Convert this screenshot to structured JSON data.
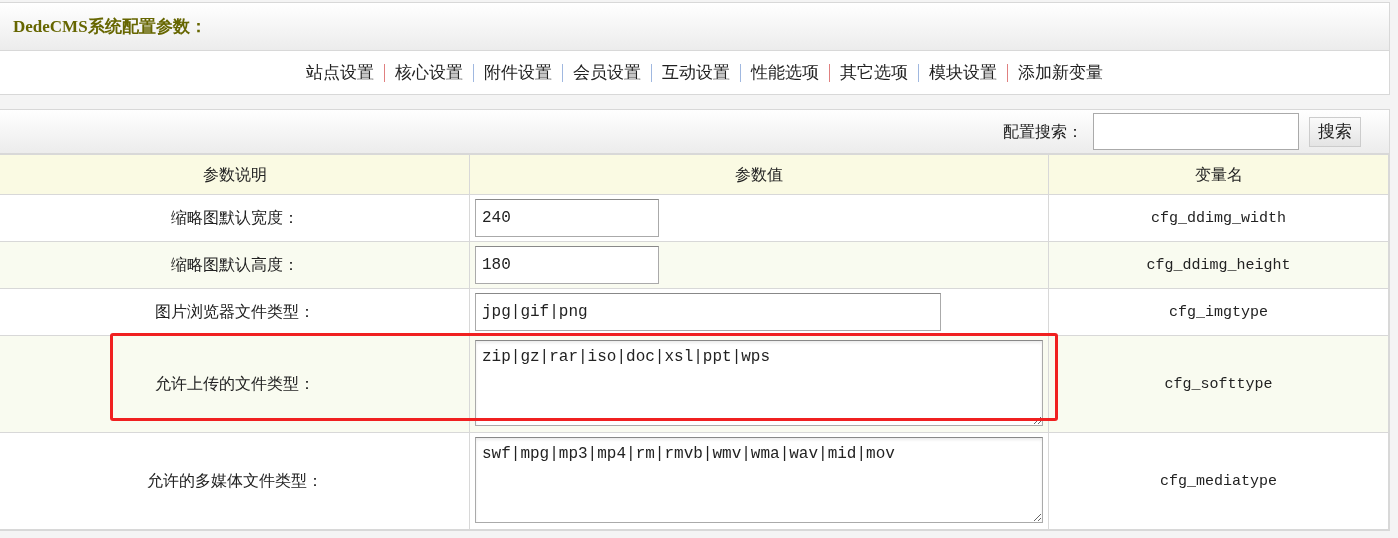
{
  "title": "DedeCMS系统配置参数：",
  "nav": [
    {
      "label": "站点设置",
      "color": "#e08080"
    },
    {
      "label": "核心设置",
      "color": "#a0b8e0"
    },
    {
      "label": "附件设置",
      "color": "#a0b8e0"
    },
    {
      "label": "会员设置",
      "color": "#a0b8e0"
    },
    {
      "label": "互动设置",
      "color": "#a0b8e0"
    },
    {
      "label": "性能选项",
      "color": "#e08080"
    },
    {
      "label": "其它选项",
      "color": "#a0b8e0"
    },
    {
      "label": "模块设置",
      "color": "#e08080"
    },
    {
      "label": "添加新变量"
    }
  ],
  "search": {
    "label": "配置搜索：",
    "button": "搜索"
  },
  "table": {
    "columns": [
      "参数说明",
      "参数值",
      "变量名"
    ],
    "rows": [
      {
        "label": "缩略图默认宽度：",
        "kind": "short",
        "value": "240",
        "variable": "cfg_ddimg_width",
        "highlighted": false
      },
      {
        "label": "缩略图默认高度：",
        "kind": "short",
        "value": "180",
        "variable": "cfg_ddimg_height",
        "highlighted": false
      },
      {
        "label": "图片浏览器文件类型：",
        "kind": "long",
        "value": "jpg|gif|png",
        "variable": "cfg_imgtype",
        "highlighted": false
      },
      {
        "label": "允许上传的文件类型：",
        "kind": "textarea",
        "value": "zip|gz|rar|iso|doc|xsl|ppt|wps",
        "variable": "cfg_softtype",
        "highlighted": true
      },
      {
        "label": "允许的多媒体文件类型：",
        "kind": "textarea",
        "value": "swf|mpg|mp3|mp4|rm|rmvb|wmv|wma|wav|mid|mov",
        "variable": "cfg_mediatype",
        "highlighted": false
      }
    ]
  }
}
